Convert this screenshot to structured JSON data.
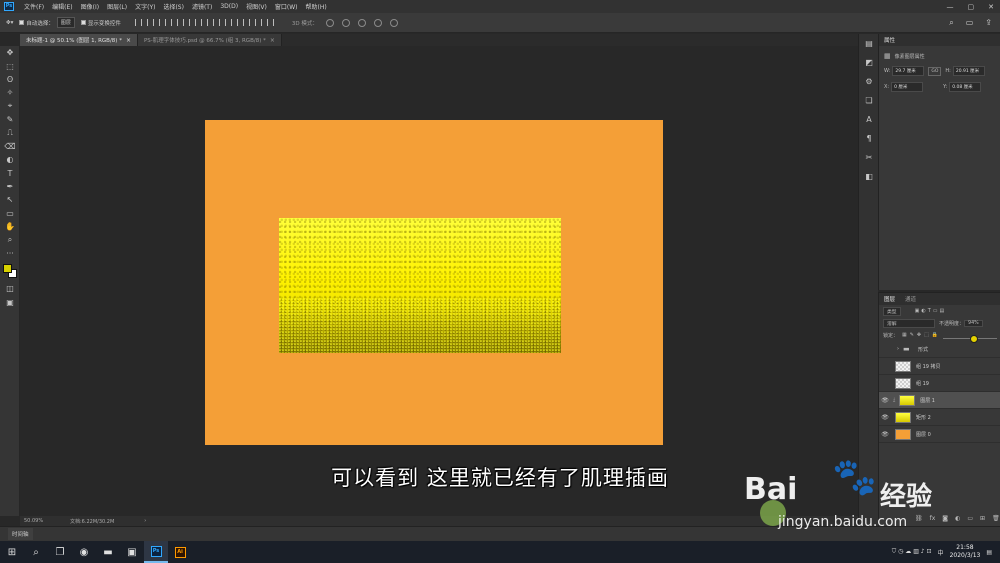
{
  "app": {
    "logo": "Ps",
    "menu": [
      "文件(F)",
      "编辑(E)",
      "图像(I)",
      "图层(L)",
      "文字(Y)",
      "选择(S)",
      "滤镜(T)",
      "3D(D)",
      "视图(V)",
      "窗口(W)",
      "帮助(H)"
    ],
    "window_controls": [
      "—",
      "▢",
      "✕"
    ]
  },
  "options": {
    "auto_select_label": "自动选择：",
    "auto_select_value": "图层",
    "transform_label": "显示变换控件",
    "mode_3d_label": "3D 模式："
  },
  "tabs": [
    {
      "label": "未标题-1 @ 50.1% (图层 1, RGB/8) *",
      "close": "×",
      "active": true
    },
    {
      "label": "PS-肌理字体技巧.psd @ 66.7% (组 3, RGB/8) *",
      "close": "×",
      "active": false
    }
  ],
  "toolbar": {
    "tools": [
      "✥",
      "⬚",
      "ʘ",
      "✧",
      "⌖",
      "✎",
      "⎍",
      "⌫",
      "◐",
      "T",
      "✒",
      "↖",
      "▭",
      "✋",
      "⌕",
      "···"
    ]
  },
  "properties": {
    "tab": "属性",
    "title": "像素图层属性",
    "w_label": "W:",
    "w_value": "29.7 厘米",
    "h_label": "H:",
    "h_value": "20.91 厘米",
    "link": "GO",
    "x_label": "X:",
    "x_value": "0 厘米",
    "y_label": "Y:",
    "y_value": "0.08 厘米"
  },
  "layers": {
    "tabs": [
      "图层",
      "通道"
    ],
    "filter": "类型",
    "blend": "溶解",
    "opacity_label": "不透明度：",
    "opacity_value": "94%",
    "opacity_fraction": 0.94,
    "lock_label": "锁定：",
    "items": [
      {
        "name": "形式",
        "visible": false,
        "thumb": "folder",
        "selected": false
      },
      {
        "name": "组 19 拷贝",
        "visible": false,
        "thumb": "transparent",
        "selected": false
      },
      {
        "name": "组 19",
        "visible": false,
        "thumb": "transparent",
        "selected": false
      },
      {
        "name": "图层 1",
        "visible": true,
        "thumb": "yellow",
        "selected": true
      },
      {
        "name": "矩形 2",
        "visible": true,
        "thumb": "yellow",
        "selected": false
      },
      {
        "name": "图层 0",
        "visible": true,
        "thumb": "orange",
        "selected": false
      }
    ]
  },
  "status": {
    "zoom": "50.09%",
    "doc_info": "文档:6.22M/30.2M",
    "arrow": "›"
  },
  "timeline": {
    "label": "时间轴"
  },
  "subtitle": "可以看到 这里就已经有了肌理插画",
  "watermark": {
    "brand_left": "Bai",
    "brand_paw": "🐾",
    "brand_right": "经验",
    "url": "jingyan.baidu.com"
  },
  "taskbar": {
    "time": "21:58",
    "date": "2020/3/13",
    "ime": "中",
    "ps_label": "Ps",
    "ai_label": "Ai"
  },
  "colors": {
    "canvas_orange": "#f49f37",
    "texture_yellow": "#fff200",
    "foreground": "#d7d100",
    "background": "#ffffff"
  }
}
